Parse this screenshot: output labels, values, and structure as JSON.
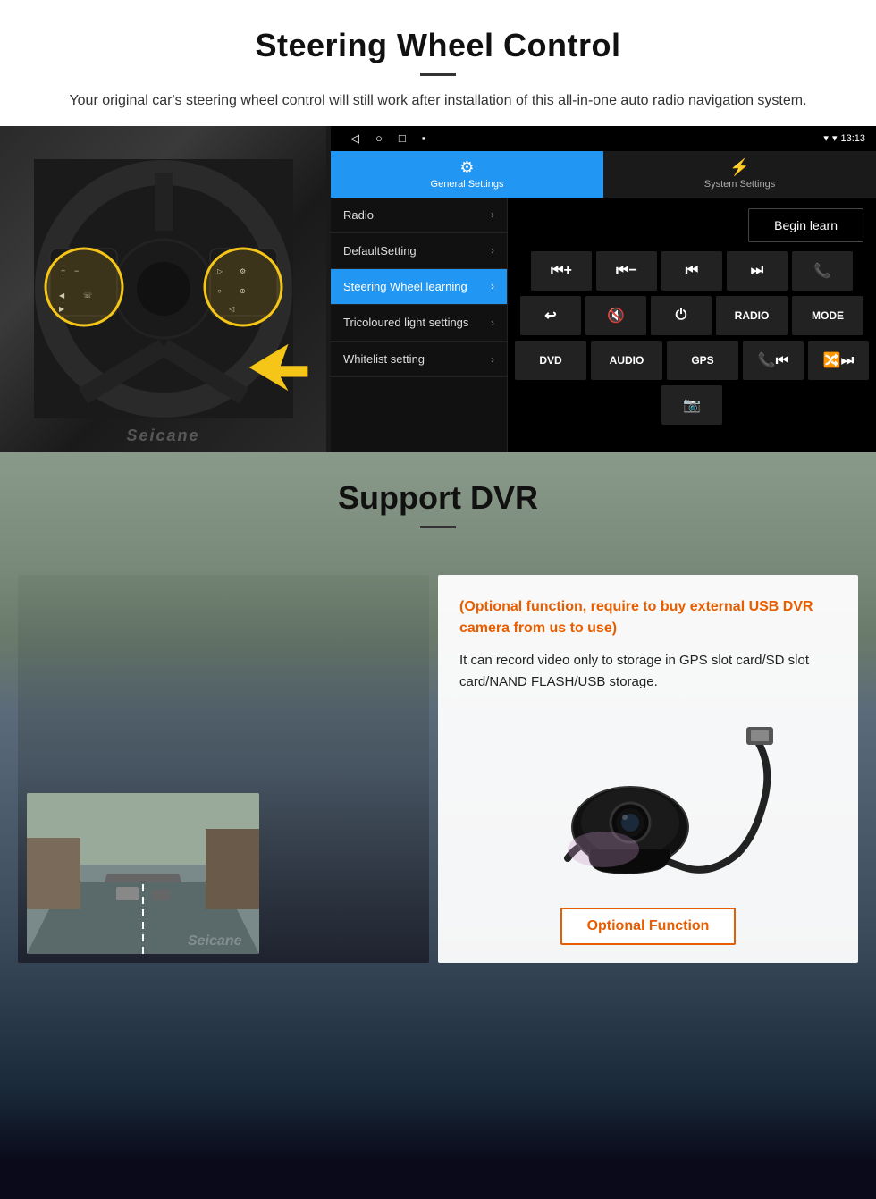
{
  "header": {
    "title": "Steering Wheel Control",
    "subtitle": "Your original car's steering wheel control will still work after installation of this all-in-one auto radio navigation system.",
    "divider": true
  },
  "android_ui": {
    "status_bar": {
      "time": "13:13",
      "signal_icon": "▾",
      "wifi_icon": "▾"
    },
    "tabs": [
      {
        "id": "general",
        "label": "General Settings",
        "icon": "⚙",
        "active": true
      },
      {
        "id": "system",
        "label": "System Settings",
        "icon": "⚡",
        "active": false
      }
    ],
    "menu_items": [
      {
        "label": "Radio",
        "active": false
      },
      {
        "label": "DefaultSetting",
        "active": false
      },
      {
        "label": "Steering Wheel learning",
        "active": true
      },
      {
        "label": "Tricoloured light settings",
        "active": false
      },
      {
        "label": "Whitelist setting",
        "active": false
      }
    ],
    "begin_learn_label": "Begin learn",
    "control_rows": [
      [
        "⏮+",
        "⏮−",
        "⏮⏮",
        "⏭⏭",
        "📞"
      ],
      [
        "↩",
        "🔇",
        "⏻",
        "RADIO",
        "MODE"
      ],
      [
        "DVD",
        "AUDIO",
        "GPS",
        "📞⏮",
        "🔀⏭"
      ],
      [
        "📷"
      ]
    ]
  },
  "dvr_section": {
    "title": "Support DVR",
    "optional_text": "(Optional function, require to buy external USB DVR camera from us to use)",
    "description": "It can record video only to storage in GPS slot card/SD slot card/NAND FLASH/USB storage.",
    "optional_badge": "Optional Function",
    "watermark": "Seicane"
  }
}
